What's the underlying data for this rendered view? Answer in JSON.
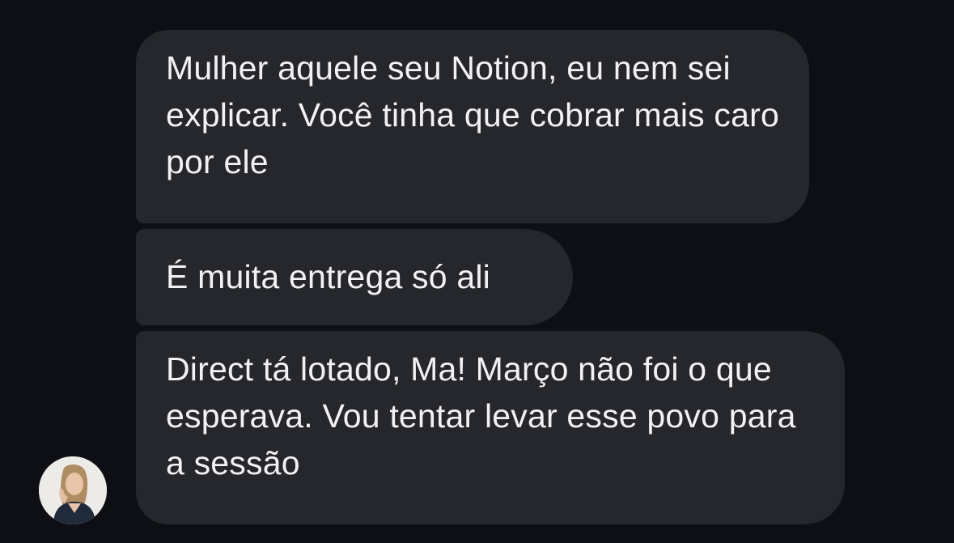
{
  "conversation": {
    "messages": [
      {
        "text": "Mulher aquele seu Notion, eu nem sei explicar. Você tinha que cobrar mais caro por ele"
      },
      {
        "text": "É muita entrega só ali"
      },
      {
        "text": "Direct tá lotado, Ma! Março não foi o que esperava. Vou tentar levar esse povo para a sessão"
      }
    ],
    "sender_avatar_icon": "profile-photo"
  },
  "colors": {
    "background": "#0d0f14",
    "bubble": "#25272d",
    "text": "#f2f2f4"
  }
}
